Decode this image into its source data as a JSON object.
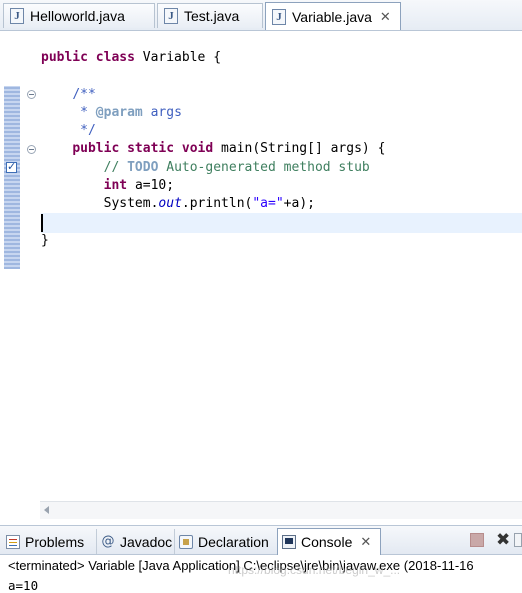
{
  "editor_tabs": [
    {
      "label": "Helloworld.java",
      "icon": "java-file-icon"
    },
    {
      "label": "Test.java",
      "icon": "java-file-icon"
    },
    {
      "label": "Variable.java",
      "icon": "java-file-icon",
      "active": true,
      "close": "✕"
    }
  ],
  "code": {
    "l1_kw": "public class ",
    "l1_rest": "Variable {",
    "l3": "/**",
    "l4_pre": " * ",
    "l4_tag": "@param",
    "l4_rest": " args",
    "l5": " */",
    "l6_kw": "public static void ",
    "l6_rest": "main(String[] args) {",
    "l7_slashes": "// ",
    "l7_todo": "TODO",
    "l7_rest": " Auto-generated method stub",
    "l8_kw": "int ",
    "l8_rest": "a=10;",
    "l9_pre": "System.",
    "l9_field": "out",
    "l9_mid": ".println(",
    "l9_str": "\"a=\"",
    "l9_end": "+a);",
    "l12": "}",
    "l14": "}"
  },
  "bottom_tabs": [
    {
      "label": "Problems",
      "icon": "problems-icon"
    },
    {
      "label": "Javadoc",
      "icon": "javadoc-icon",
      "glyph": "@"
    },
    {
      "label": "Declaration",
      "icon": "declaration-icon"
    },
    {
      "label": "Console",
      "icon": "console-icon",
      "active": true,
      "close": "✕"
    }
  ],
  "console": {
    "header": "<terminated> Variable [Java Application] C:\\eclipse\\jre\\bin\\javaw.exe (2018-11-16",
    "output": "a=10"
  },
  "toolbar": {
    "remove_glyph": "✖"
  },
  "watermark": "https://blog.csdn.net/begin_w_..."
}
